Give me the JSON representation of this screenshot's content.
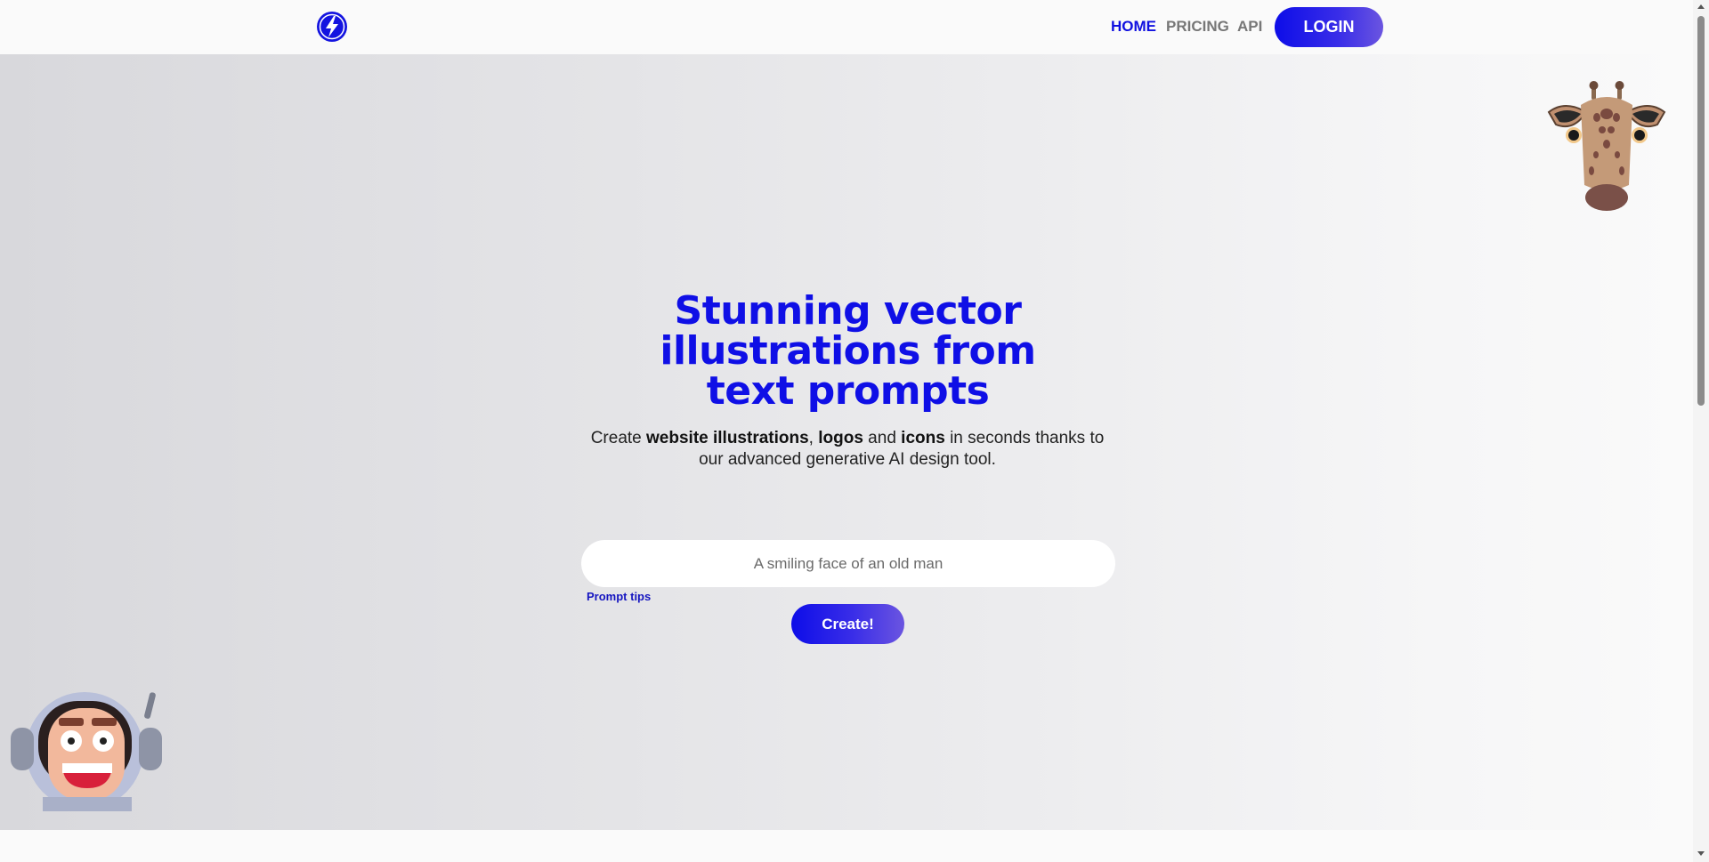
{
  "brand": {
    "logo_icon": "lightning-bolt-icon",
    "accent": "#0f0fe6"
  },
  "nav": {
    "items": [
      {
        "label": "HOME",
        "active": true
      },
      {
        "label": "PRICING",
        "active": false
      },
      {
        "label": "API",
        "active": false
      }
    ],
    "login_label": "LOGIN"
  },
  "hero": {
    "title": "Stunning vector illustrations from text prompts",
    "subtitle": {
      "t1": "Create ",
      "b1": "website illustrations",
      "t2": ", ",
      "b2": "logos",
      "t3": " and ",
      "b3": "icons",
      "t4": " in seconds thanks to our advanced generative AI design tool."
    },
    "prompt_placeholder": "A smiling face of an old man",
    "prompt_value": "",
    "prompt_tips_label": "Prompt tips",
    "create_label": "Create!"
  },
  "decorations": {
    "top_right": "giraffe-illustration",
    "bottom_left": "astronaut-illustration"
  }
}
